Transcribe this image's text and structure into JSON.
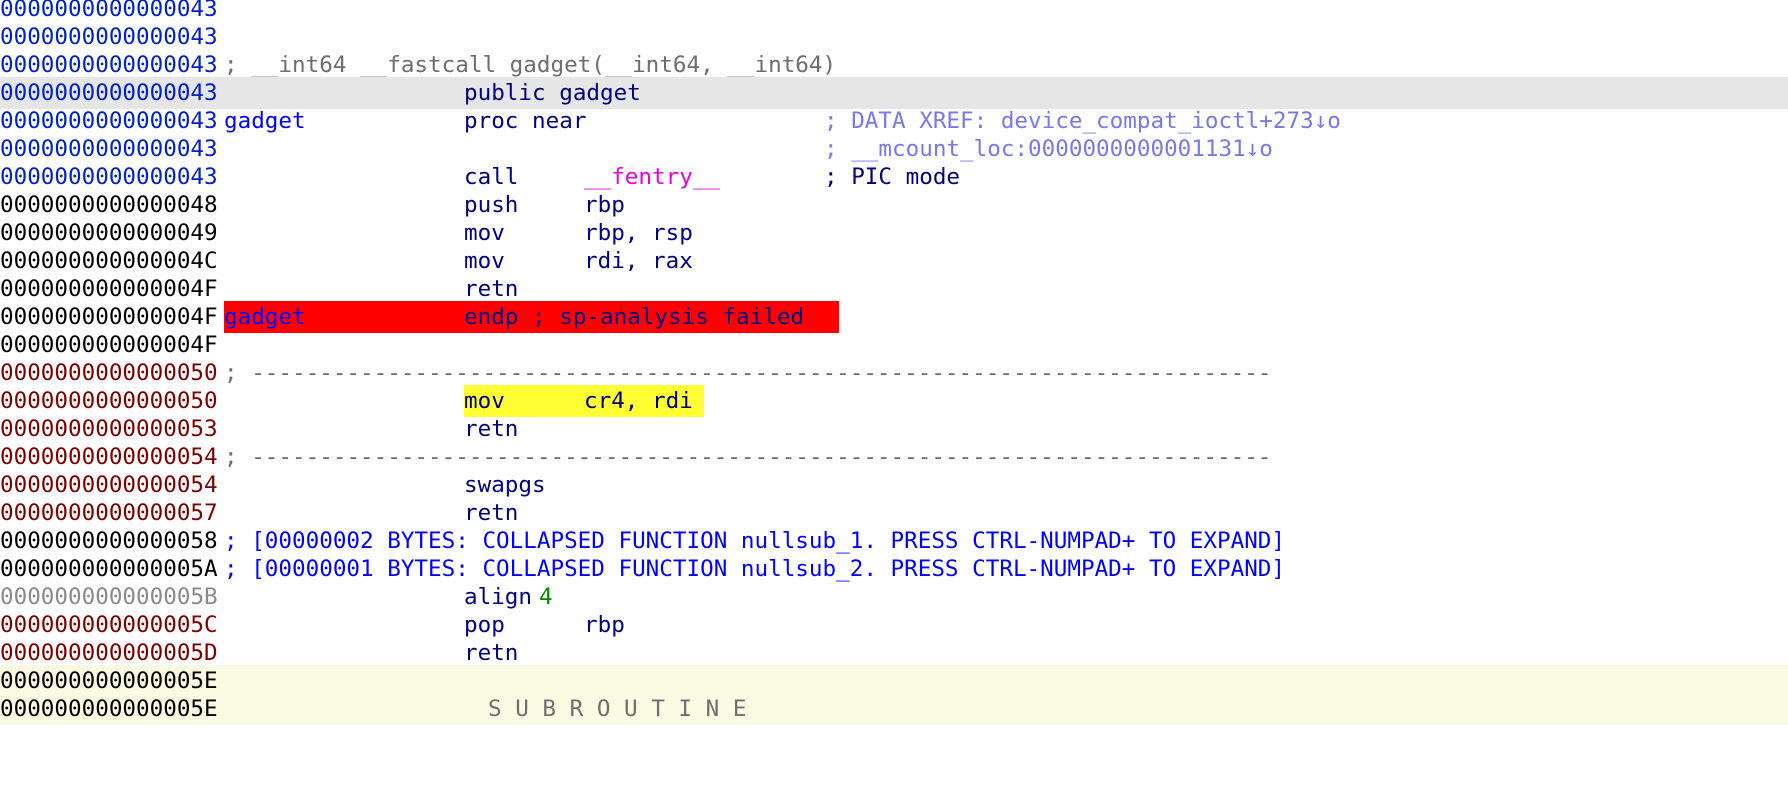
{
  "colors": {
    "address_blue": "#0021c6",
    "address_maroon": "#7a0000",
    "instruction": "#000080",
    "error_highlight": "#ff0000",
    "selection_highlight": "#ffff33",
    "current_line": "#e6e6e6",
    "xref_comment": "#7878e8",
    "import_name": "#e400e4",
    "number": "#008a00"
  },
  "lines": [
    {
      "addr": "0000000000000043"
    },
    {
      "addr": "0000000000000043"
    },
    {
      "addr": "0000000000000043",
      "comment": "; __int64 __fastcall gadget(__int64, __int64)"
    },
    {
      "addr": "0000000000000043",
      "directive": "public gadget"
    },
    {
      "addr": "0000000000000043",
      "label": "gadget",
      "directive": "proc near",
      "comment": "; DATA XREF: device_compat_ioctl+273↓o"
    },
    {
      "addr": "0000000000000043",
      "comment": "; __mcount_loc:0000000000001131↓o"
    },
    {
      "addr": "0000000000000043",
      "mnemonic": "call",
      "operand": "__fentry__",
      "comment": "; PIC mode"
    },
    {
      "addr": "0000000000000048",
      "mnemonic": "push",
      "operand": "rbp"
    },
    {
      "addr": "0000000000000049",
      "mnemonic": "mov",
      "operand": "rbp, rsp"
    },
    {
      "addr": "000000000000004C",
      "mnemonic": "mov",
      "operand": "rdi, rax"
    },
    {
      "addr": "000000000000004F",
      "mnemonic": "retn"
    },
    {
      "addr": "000000000000004F",
      "label": "gadget",
      "directive": "endp ; sp-analysis failed"
    },
    {
      "addr": "000000000000004F"
    },
    {
      "addr": "0000000000000050",
      "separator": "; ---------------------------------------------------------------------------"
    },
    {
      "addr": "0000000000000050",
      "mnemonic": "mov",
      "operand": "cr4, rdi"
    },
    {
      "addr": "0000000000000053",
      "mnemonic": "retn"
    },
    {
      "addr": "0000000000000054",
      "separator": "; ---------------------------------------------------------------------------"
    },
    {
      "addr": "0000000000000054",
      "mnemonic": "swapgs"
    },
    {
      "addr": "0000000000000057",
      "mnemonic": "retn"
    },
    {
      "addr": "0000000000000058",
      "collapsed": "; [00000002 BYTES: COLLAPSED FUNCTION nullsub_1. PRESS CTRL-NUMPAD+ TO EXPAND]"
    },
    {
      "addr": "000000000000005A",
      "collapsed": "; [00000001 BYTES: COLLAPSED FUNCTION nullsub_2. PRESS CTRL-NUMPAD+ TO EXPAND]"
    },
    {
      "addr": "000000000000005B",
      "mnemonic": "align",
      "operand": "4"
    },
    {
      "addr": "000000000000005C",
      "mnemonic": "pop",
      "operand": "rbp"
    },
    {
      "addr": "000000000000005D",
      "mnemonic": "retn"
    },
    {
      "addr": "000000000000005E"
    },
    {
      "addr": "000000000000005E",
      "partial": "S U B R O U T I N E"
    }
  ]
}
